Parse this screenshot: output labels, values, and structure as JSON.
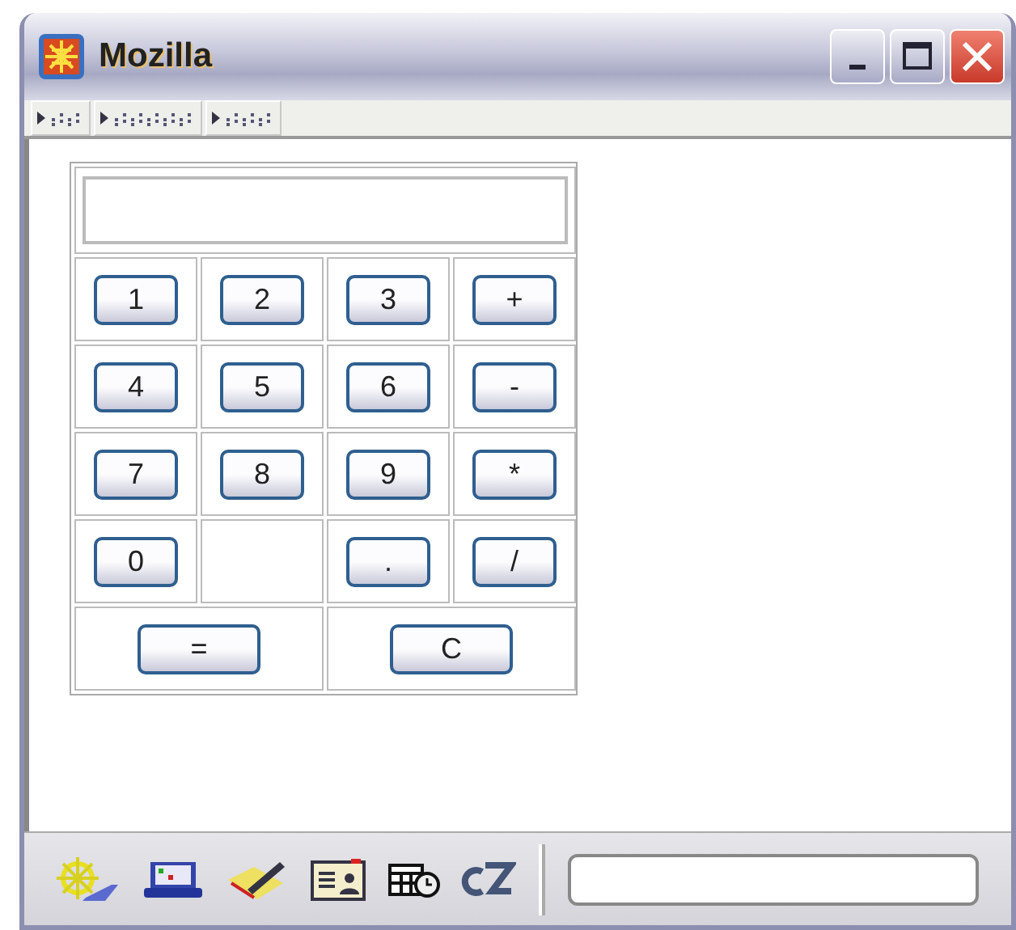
{
  "window": {
    "title": "Mozilla"
  },
  "calculator": {
    "rows": [
      [
        {
          "kind": "key",
          "label": "1"
        },
        {
          "kind": "key",
          "label": "2"
        },
        {
          "kind": "key",
          "label": "3"
        },
        {
          "kind": "key",
          "label": "+"
        }
      ],
      [
        {
          "kind": "key",
          "label": "4"
        },
        {
          "kind": "key",
          "label": "5"
        },
        {
          "kind": "key",
          "label": "6"
        },
        {
          "kind": "key",
          "label": "-"
        }
      ],
      [
        {
          "kind": "key",
          "label": "7"
        },
        {
          "kind": "key",
          "label": "8"
        },
        {
          "kind": "key",
          "label": "9"
        },
        {
          "kind": "key",
          "label": "*"
        }
      ],
      [
        {
          "kind": "key",
          "label": "0"
        },
        {
          "kind": "empty"
        },
        {
          "kind": "key",
          "label": "."
        },
        {
          "kind": "key",
          "label": "/"
        }
      ],
      [
        {
          "kind": "wide",
          "label": "="
        },
        {
          "kind": "wide",
          "label": "C"
        }
      ]
    ]
  }
}
